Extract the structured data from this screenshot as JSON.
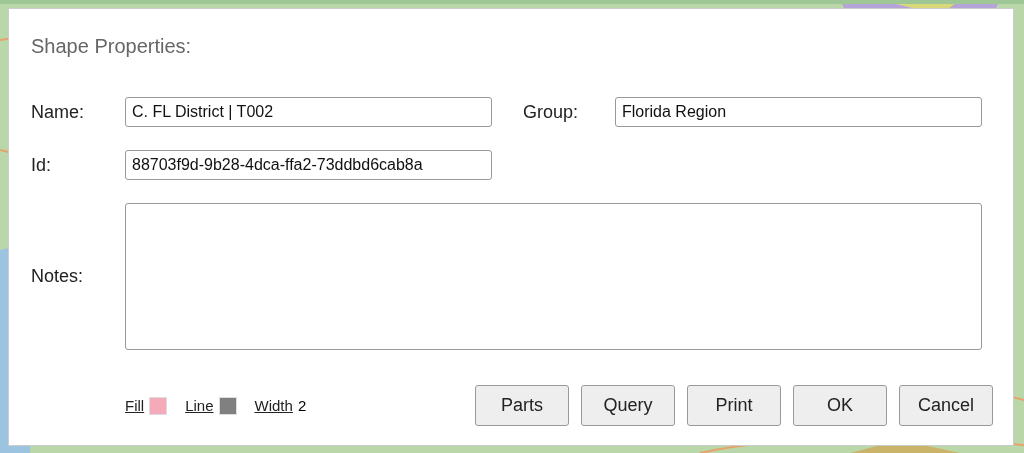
{
  "dialog": {
    "title": "Shape Properties:",
    "fields": [
      {
        "label": "Name:",
        "value": "C. FL District | T002"
      },
      {
        "label": "Group:",
        "value": "Florida Region"
      },
      {
        "label": "Id:",
        "value": "88703f9d-9b28-4dca-ffa2-73ddbd6cab8a"
      }
    ],
    "notes": {
      "label": "Notes:"
    },
    "style": [
      {
        "kind": "swatch",
        "label": "Fill",
        "color": "#f4aab9"
      },
      {
        "kind": "swatch",
        "label": "Line",
        "color": "#808080"
      },
      {
        "kind": "value",
        "label": "Width",
        "value": "2"
      }
    ],
    "buttons": [
      "Parts",
      "Query",
      "Print",
      "OK",
      "Cancel"
    ]
  }
}
